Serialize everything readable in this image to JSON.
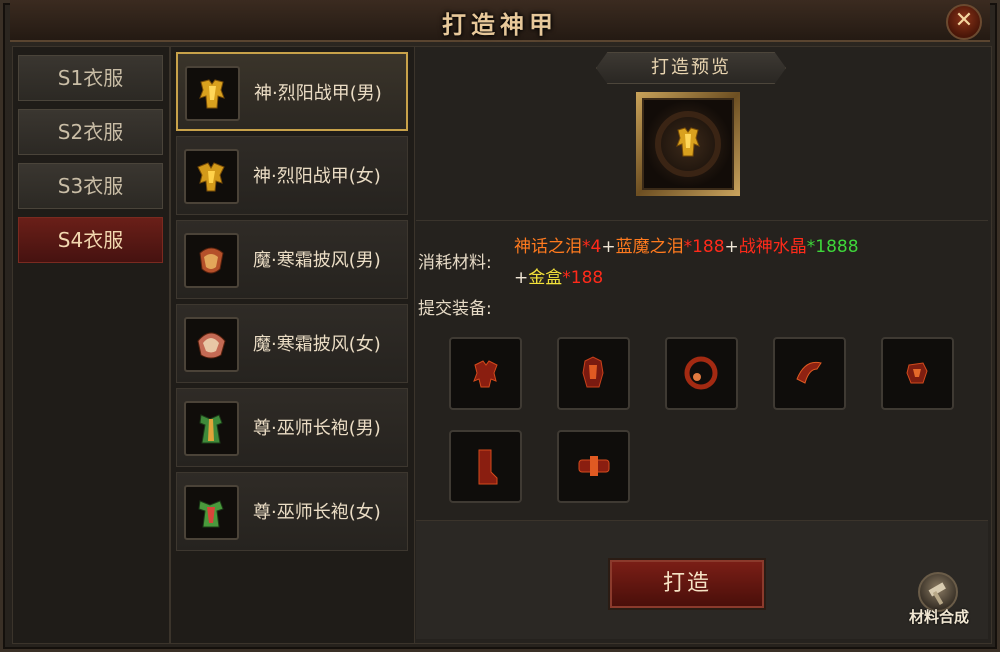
{
  "window": {
    "title": "打造神甲",
    "close_label": "✕"
  },
  "tabs": [
    {
      "label": "S1衣服",
      "active": false
    },
    {
      "label": "S2衣服",
      "active": false
    },
    {
      "label": "S3衣服",
      "active": false
    },
    {
      "label": "S4衣服",
      "active": true
    }
  ],
  "items": [
    {
      "name": "神·烈阳战甲(男)",
      "icon": "golden-armor-icon",
      "selected": true
    },
    {
      "name": "神·烈阳战甲(女)",
      "icon": "golden-armor-icon",
      "selected": false
    },
    {
      "name": "魔·寒霜披风(男)",
      "icon": "cloak-icon",
      "selected": false
    },
    {
      "name": "魔·寒霜披风(女)",
      "icon": "cloak-icon",
      "selected": false
    },
    {
      "name": "尊·巫师长袍(男)",
      "icon": "robe-icon",
      "selected": false
    },
    {
      "name": "尊·巫师长袍(女)",
      "icon": "robe-icon",
      "selected": false
    }
  ],
  "preview": {
    "title": "打造预览",
    "icon": "golden-armor-icon"
  },
  "materials": {
    "label": "消耗材料:",
    "line1": [
      {
        "text": "神话之泪",
        "color": "#ff7a1e"
      },
      {
        "text": "*4",
        "color": "#ff2a1a"
      },
      {
        "text": "+",
        "color": "#f0e6d6"
      },
      {
        "text": "蓝魔之泪",
        "color": "#ff7a1e"
      },
      {
        "text": "*188",
        "color": "#ff2a1a"
      },
      {
        "text": "+",
        "color": "#f0e6d6"
      },
      {
        "text": "战神水晶",
        "color": "#ff2a1a"
      },
      {
        "text": "*1888",
        "color": "#3ed63a"
      }
    ],
    "line2": [
      {
        "text": "+",
        "color": "#f0e6d6"
      },
      {
        "text": "金盒",
        "color": "#f3e23a"
      },
      {
        "text": "*188",
        "color": "#ff2a1a"
      }
    ]
  },
  "submit": {
    "label": "提交装备:",
    "slots": [
      "armor-piece-icon",
      "armor-piece-icon",
      "helmet-icon",
      "bracer-icon",
      "gauntlet-icon",
      "boot-icon",
      "belt-icon"
    ]
  },
  "actions": {
    "forge_label": "打造",
    "synth_label": "材料合成"
  }
}
